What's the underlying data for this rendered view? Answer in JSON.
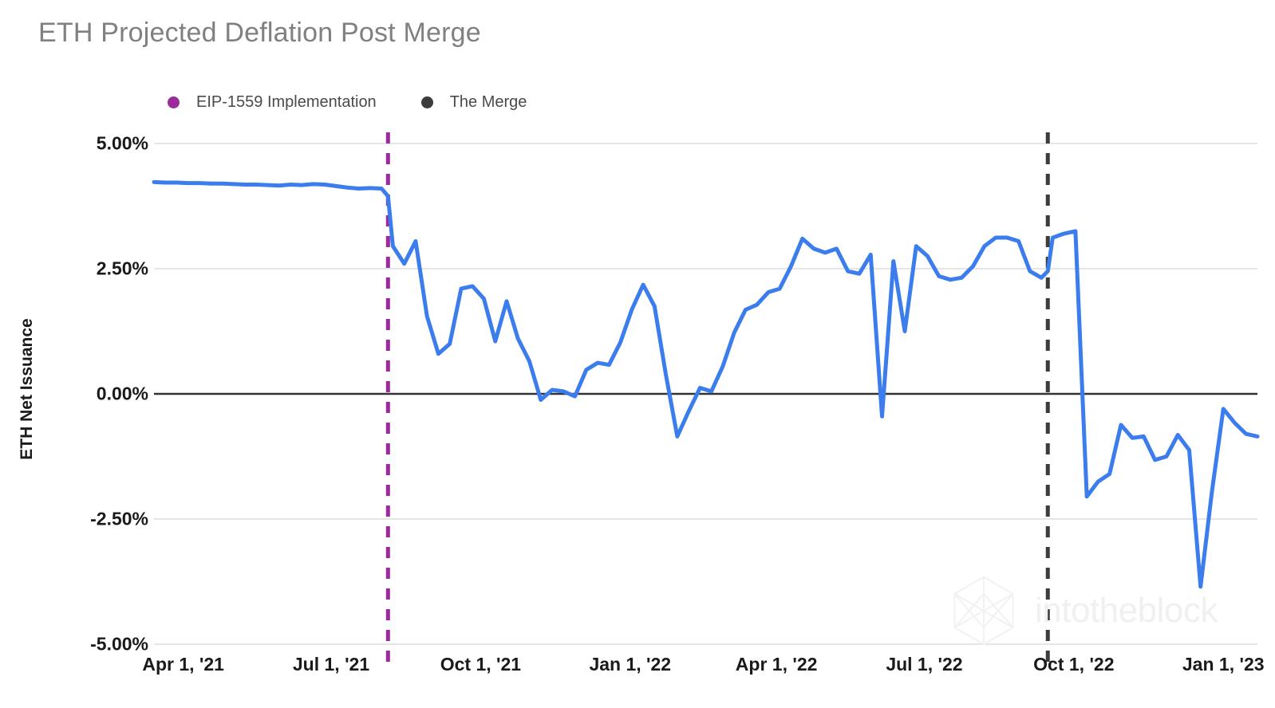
{
  "title": "ETH Projected Deflation Post Merge",
  "watermark": {
    "brand": "intotheblock",
    "logo_icon": "hexagon-logo-icon"
  },
  "legend": [
    {
      "label": "EIP-1559 Implementation",
      "color": "#9c2a9c",
      "icon": "legend-dot-icon"
    },
    {
      "label": "The Merge",
      "color": "#3c3c3c",
      "icon": "legend-dot-icon"
    }
  ],
  "chart_data": {
    "type": "line",
    "title": "ETH Projected Deflation Post Merge",
    "xlabel": "",
    "ylabel": "ETH Net Issuance",
    "ylim": [
      -5.0,
      5.0
    ],
    "yticks": [
      5.0,
      2.5,
      0.0,
      -2.5,
      -5.0
    ],
    "ytick_labels": [
      "5.00%",
      "2.50%",
      "0.00%",
      "-2.50%",
      "-5.00%"
    ],
    "xlim": [
      "2021-03-14",
      "2023-01-22"
    ],
    "xticks": [
      "2021-04-01",
      "2021-07-01",
      "2021-10-01",
      "2022-01-01",
      "2022-04-01",
      "2022-07-01",
      "2022-10-01",
      "2023-01-01"
    ],
    "xtick_labels": [
      "Apr 1, '21",
      "Jul 1, '21",
      "Oct 1, '21",
      "Jan 1, '22",
      "Apr 1, '22",
      "Jul 1, '22",
      "Oct 1, '22",
      "Jan 1, '23"
    ],
    "grid": true,
    "zero_line": true,
    "legend_position": "top-left",
    "series": [
      {
        "name": "ETH Net Issuance",
        "color": "#3b7ded",
        "x": [
          "2021-03-14",
          "2021-03-21",
          "2021-03-28",
          "2021-04-04",
          "2021-04-11",
          "2021-04-18",
          "2021-04-25",
          "2021-05-02",
          "2021-05-09",
          "2021-05-16",
          "2021-05-23",
          "2021-05-30",
          "2021-06-06",
          "2021-06-13",
          "2021-06-20",
          "2021-06-27",
          "2021-07-04",
          "2021-07-11",
          "2021-07-18",
          "2021-07-25",
          "2021-08-01",
          "2021-08-05",
          "2021-08-08",
          "2021-08-15",
          "2021-08-22",
          "2021-08-29",
          "2021-09-05",
          "2021-09-12",
          "2021-09-19",
          "2021-09-26",
          "2021-10-03",
          "2021-10-10",
          "2021-10-17",
          "2021-10-24",
          "2021-10-31",
          "2021-11-07",
          "2021-11-14",
          "2021-11-21",
          "2021-11-28",
          "2021-12-05",
          "2021-12-12",
          "2021-12-19",
          "2021-12-26",
          "2022-01-02",
          "2022-01-09",
          "2022-01-16",
          "2022-01-23",
          "2022-01-30",
          "2022-02-06",
          "2022-02-13",
          "2022-02-20",
          "2022-02-27",
          "2022-03-06",
          "2022-03-13",
          "2022-03-20",
          "2022-03-27",
          "2022-04-03",
          "2022-04-10",
          "2022-04-17",
          "2022-04-24",
          "2022-05-01",
          "2022-05-08",
          "2022-05-15",
          "2022-05-22",
          "2022-05-29",
          "2022-06-05",
          "2022-06-12",
          "2022-06-19",
          "2022-06-26",
          "2022-07-03",
          "2022-07-10",
          "2022-07-17",
          "2022-07-24",
          "2022-07-31",
          "2022-08-07",
          "2022-08-14",
          "2022-08-21",
          "2022-08-28",
          "2022-09-04",
          "2022-09-11",
          "2022-09-15",
          "2022-09-18",
          "2022-09-25",
          "2022-10-02",
          "2022-10-09",
          "2022-10-16",
          "2022-10-23",
          "2022-10-30",
          "2022-11-06",
          "2022-11-13",
          "2022-11-20",
          "2022-11-27",
          "2022-12-04",
          "2022-12-11",
          "2022-12-18",
          "2022-12-25",
          "2023-01-01",
          "2023-01-08",
          "2023-01-15",
          "2023-01-22"
        ],
        "y": [
          4.23,
          4.22,
          4.22,
          4.21,
          4.21,
          4.2,
          4.2,
          4.19,
          4.18,
          4.18,
          4.17,
          4.16,
          4.18,
          4.17,
          4.19,
          4.18,
          4.15,
          4.12,
          4.1,
          4.11,
          4.1,
          3.95,
          2.95,
          2.6,
          3.05,
          1.55,
          0.8,
          1.0,
          2.1,
          2.15,
          1.9,
          1.05,
          1.85,
          1.1,
          0.65,
          -0.12,
          0.08,
          0.05,
          -0.05,
          0.48,
          0.62,
          0.58,
          1.03,
          1.68,
          2.18,
          1.75,
          0.38,
          -0.85,
          -0.35,
          0.12,
          0.05,
          0.55,
          1.22,
          1.68,
          1.78,
          2.03,
          2.1,
          2.55,
          3.1,
          2.9,
          2.82,
          2.9,
          2.45,
          2.4,
          2.78,
          -0.45,
          2.65,
          1.25,
          2.95,
          2.75,
          2.35,
          2.28,
          2.32,
          2.55,
          2.95,
          3.12,
          3.12,
          3.05,
          2.45,
          2.32,
          2.45,
          3.12,
          3.2,
          3.25,
          -2.05,
          -1.75,
          -1.6,
          -0.62,
          -0.88,
          -0.85,
          -1.32,
          -1.25,
          -0.82,
          -1.12,
          -3.85,
          -1.95,
          -0.3,
          -0.58,
          -0.8,
          -0.85,
          -0.65
        ]
      }
    ],
    "vertical_markers": [
      {
        "label": "EIP-1559 Implementation",
        "date": "2021-08-05",
        "color": "#9c2a9c",
        "style": "dashed"
      },
      {
        "label": "The Merge",
        "date": "2022-09-15",
        "color": "#3c3c3c",
        "style": "dashed"
      }
    ]
  }
}
